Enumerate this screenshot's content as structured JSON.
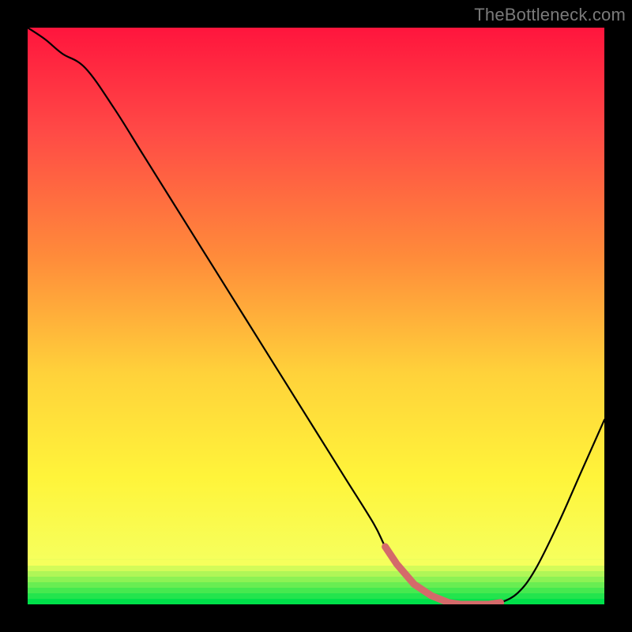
{
  "attribution": "TheBottleneck.com",
  "chart_data": {
    "type": "line",
    "title": "",
    "xlabel": "",
    "ylabel": "",
    "xlim": [
      0,
      100
    ],
    "ylim": [
      0,
      100
    ],
    "grid": false,
    "x": [
      0,
      3,
      6,
      10,
      15,
      20,
      25,
      30,
      35,
      40,
      45,
      50,
      55,
      60,
      62,
      64,
      67,
      70,
      73,
      75,
      78,
      80,
      82,
      85,
      88,
      92,
      96,
      100
    ],
    "values": [
      100,
      98,
      95.5,
      93,
      86,
      78,
      70,
      62,
      54,
      46,
      38,
      30,
      22,
      14,
      10,
      7,
      3.5,
      1.5,
      0.3,
      0,
      0,
      0,
      0.3,
      2,
      6,
      14,
      23,
      32
    ],
    "minima_band": {
      "x_start": 62,
      "x_end": 82,
      "y": 0,
      "color": "#d46a6a"
    },
    "band_color_from": "#00e04a",
    "band_color_to": "#f6ff5c"
  }
}
